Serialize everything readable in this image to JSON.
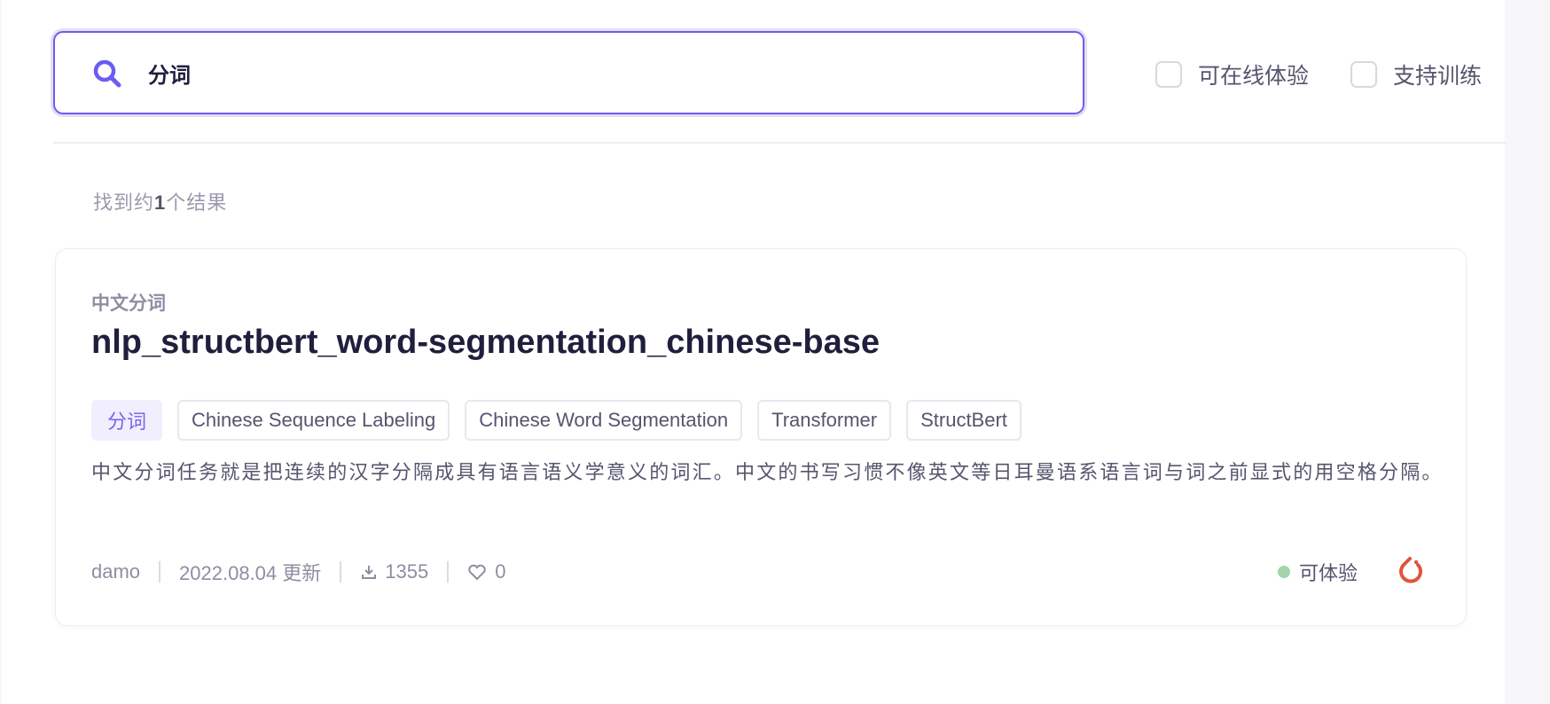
{
  "search": {
    "value": "分词",
    "icon": "search-icon"
  },
  "filters": [
    {
      "label": "可在线体验",
      "checked": false
    },
    {
      "label": "支持训练",
      "checked": false
    }
  ],
  "results": {
    "prefix": "找到约",
    "count": "1",
    "suffix": "个结果"
  },
  "card": {
    "category": "中文分词",
    "title": "nlp_structbert_word-segmentation_chinese-base",
    "tags": [
      "分词",
      "Chinese Sequence Labeling",
      "Chinese Word Segmentation",
      "Transformer",
      "StructBert"
    ],
    "description": "中文分词任务就是把连续的汉字分隔成具有语言语义学意义的词汇。中文的书写习惯不像英文等日耳曼语系语言词与词之前显式的用空格分隔。",
    "author": "damo",
    "updated": "2022.08.04 更新",
    "downloads": "1355",
    "likes": "0",
    "status": "可体验",
    "status_color": "#a3d5a8",
    "framework_icon": "pytorch-icon",
    "accent": "#6b5cf2"
  }
}
